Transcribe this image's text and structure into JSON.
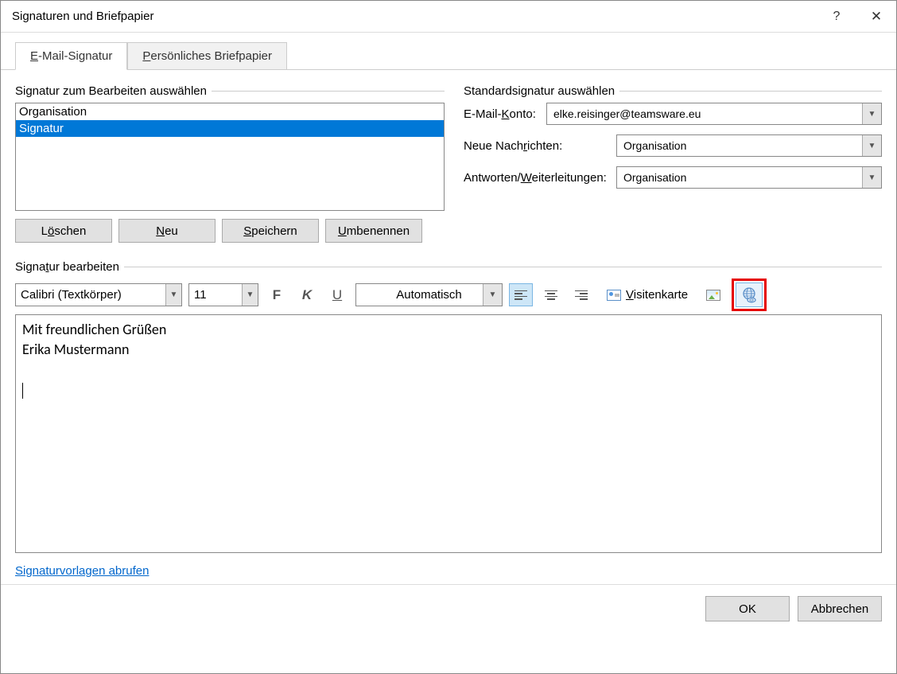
{
  "title": "Signaturen und Briefpapier",
  "titlebar": {
    "help": "?",
    "close": "✕"
  },
  "tabs": {
    "signature": {
      "accel": "E",
      "rest": "-Mail-Signatur"
    },
    "stationery": {
      "accel": "P",
      "rest": "ersönliches Briefpapier"
    }
  },
  "left": {
    "heading": "Signatur zum Bearbeiten auswählen",
    "items": [
      "Organisation",
      "Signatur"
    ],
    "selected_index": 1,
    "buttons": {
      "delete": {
        "pre": "L",
        "accel": "ö",
        "post": "schen"
      },
      "new": {
        "pre": "",
        "accel": "N",
        "post": "eu"
      },
      "save": {
        "pre": "",
        "accel": "S",
        "post": "peichern"
      },
      "rename": {
        "pre": "",
        "accel": "U",
        "post": "mbenennen"
      }
    }
  },
  "right": {
    "heading": "Standardsignatur auswählen",
    "account_label": {
      "pre": "E-Mail-",
      "accel": "K",
      "post": "onto:"
    },
    "account_value": "elke.reisinger@teamsware.eu",
    "newmsg_label": {
      "pre": "Neue Nach",
      "accel": "r",
      "post": "ichten:"
    },
    "newmsg_value": "Organisation",
    "reply_label": {
      "pre": "Antworten/",
      "accel": "W",
      "post": "eiterleitungen:"
    },
    "reply_value": "Organisation"
  },
  "edit": {
    "heading": {
      "pre": "Signa",
      "accel": "t",
      "post": "ur bearbeiten"
    },
    "font": "Calibri (Textkörper)",
    "size": "11",
    "bold": "F",
    "italic": "K",
    "underline": "U",
    "color": "Automatisch",
    "vcard": {
      "accel": "V",
      "rest": "isitenkarte"
    },
    "content_line1": "Mit freundlichen Grüßen",
    "content_line2": "Erika Mustermann"
  },
  "templates_link": "Signaturvorlagen abrufen",
  "footer": {
    "ok": "OK",
    "cancel": "Abbrechen"
  }
}
